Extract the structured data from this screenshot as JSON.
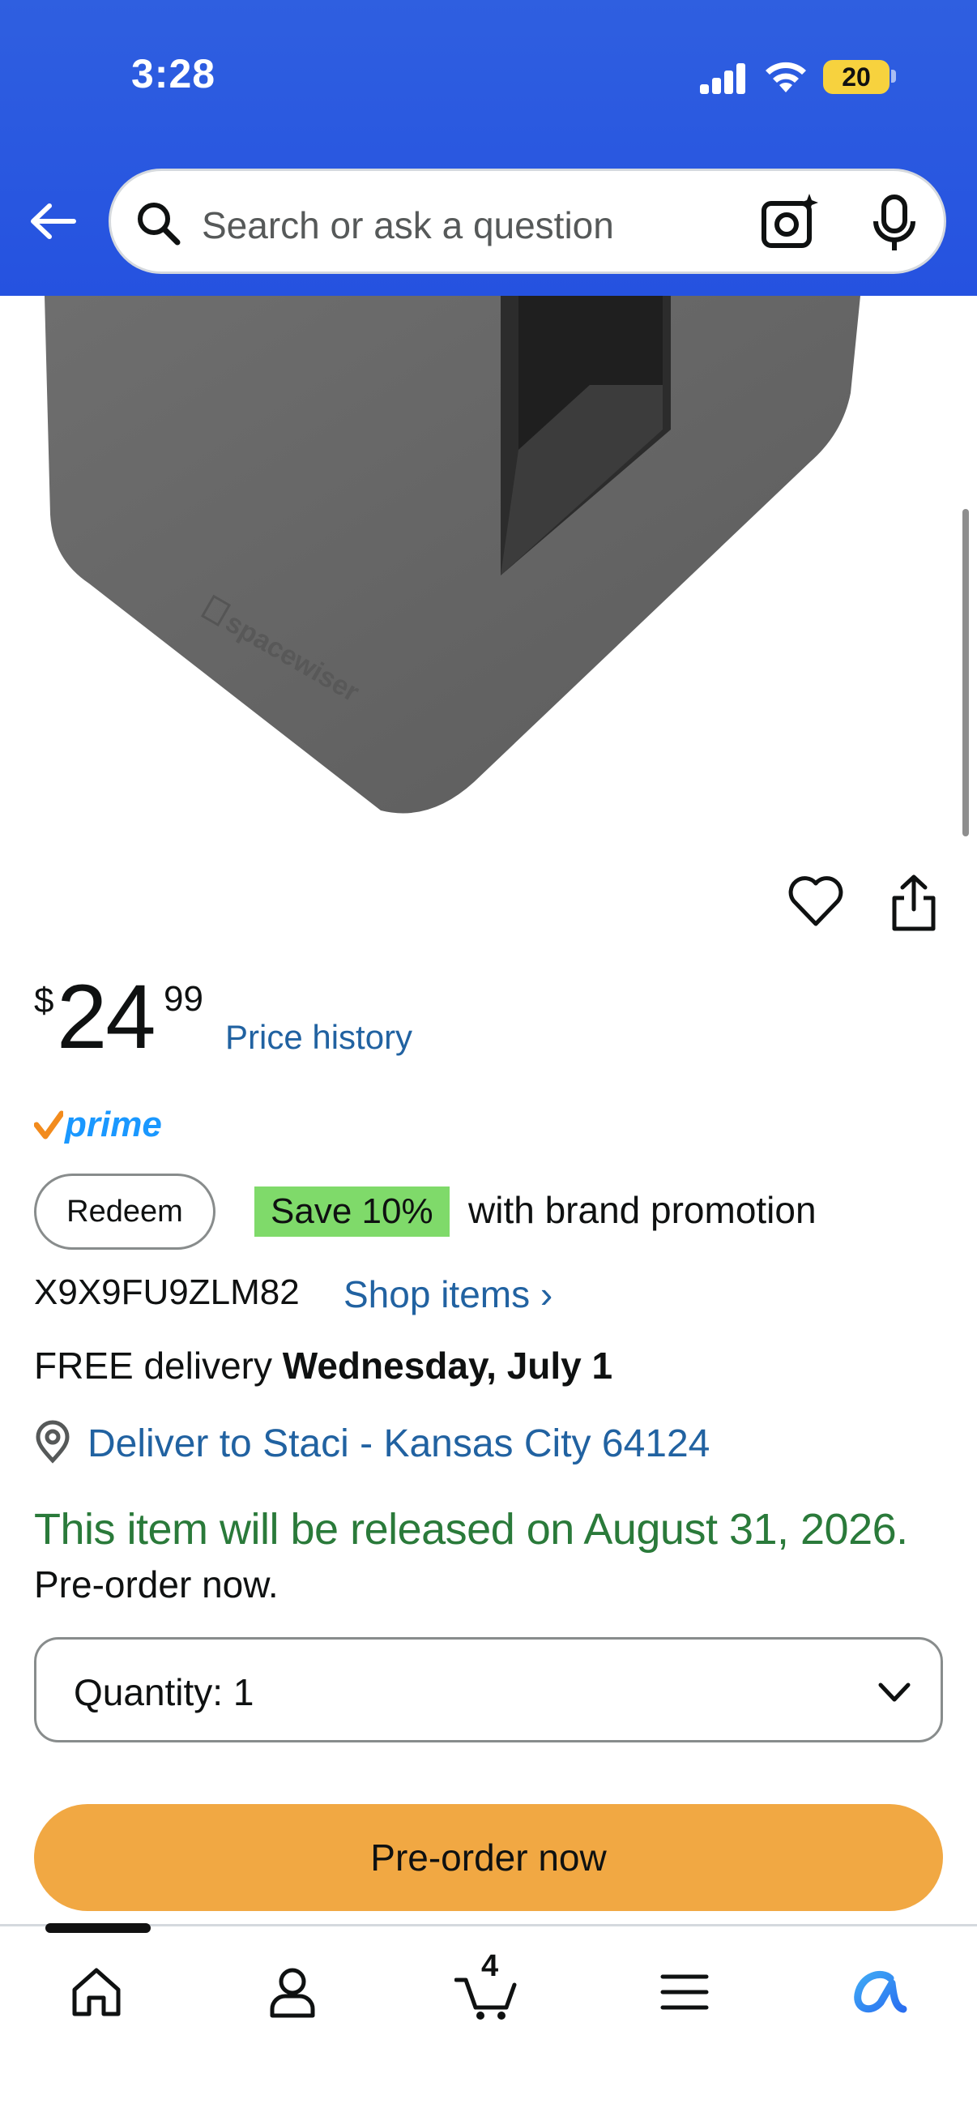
{
  "status_bar": {
    "time": "3:28",
    "battery": "20"
  },
  "search": {
    "placeholder": "Search or ask a question"
  },
  "product": {
    "brand_watermark": "spacewiser",
    "price_symbol": "$",
    "price_whole": "24",
    "price_fraction": "99",
    "price_history_label": "Price history",
    "prime_label": "prime",
    "redeem_label": "Redeem",
    "save_badge": "Save 10%",
    "promo_text": "with brand promotion",
    "seller_code": "X9X9FU9ZLM82",
    "shop_items_label": "Shop items ›",
    "delivery_prefix": "FREE delivery",
    "delivery_date": "Wednesday, July 1",
    "deliver_to": "Deliver to Staci - Kansas City 64124",
    "release_text": "This item will be released on August 31, 2026.",
    "preorder_note": "Pre-order now.",
    "quantity_label": "Quantity:  1",
    "preorder_button": "Pre-order now"
  },
  "bottom_nav": {
    "cart_count": "4",
    "items": [
      "home-icon",
      "account-icon",
      "cart-icon",
      "menu-icon",
      "rufus-icon"
    ]
  },
  "colors": {
    "header_blue": "#2552e0",
    "link_blue": "#2162a1",
    "release_green": "#2a7a3a",
    "save_green": "#7fda6a",
    "preorder_orange": "#f1a843",
    "prime_blue": "#1a98ff"
  }
}
